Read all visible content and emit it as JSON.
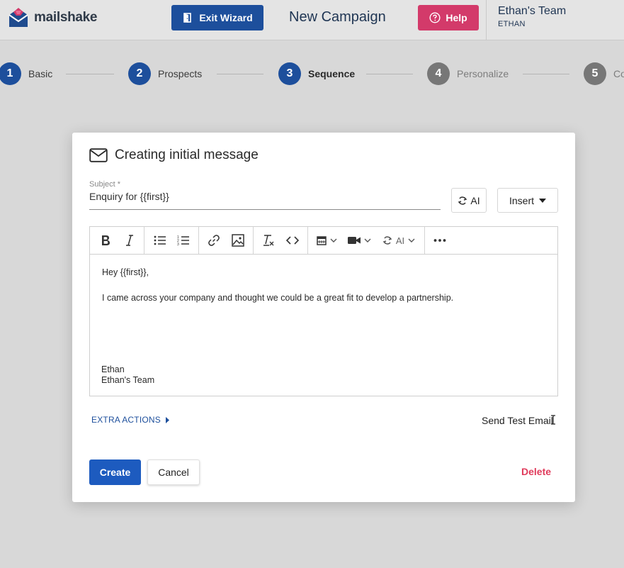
{
  "header": {
    "brand": "mailshake",
    "exit_wizard": "Exit Wizard",
    "title": "New Campaign",
    "help": "Help",
    "team_name": "Ethan's Team",
    "team_user": "ETHAN"
  },
  "steps": [
    {
      "num": "1",
      "label": "Basic",
      "state": "done"
    },
    {
      "num": "2",
      "label": "Prospects",
      "state": "done"
    },
    {
      "num": "3",
      "label": "Sequence",
      "state": "current"
    },
    {
      "num": "4",
      "label": "Personalize",
      "state": "todo"
    },
    {
      "num": "5",
      "label": "Co",
      "state": "todo"
    }
  ],
  "modal": {
    "title": "Creating initial message",
    "subject_label": "Subject *",
    "subject_value": "Enquiry for {{first}}",
    "ai_button": "AI",
    "insert_button": "Insert",
    "toolbar_ai": "AI",
    "body": {
      "greeting": "Hey {{first}},",
      "line1": "I came across your company and thought we could be a great fit to develop a partnership.",
      "sig_name": "Ethan",
      "sig_team": "Ethan's Team"
    },
    "extra_actions": "EXTRA ACTIONS",
    "send_test": "Send Test Email",
    "create": "Create",
    "cancel": "Cancel",
    "delete": "Delete"
  },
  "colors": {
    "primary": "#1d4f9c",
    "create": "#1d5bbf",
    "help": "#d33a6a",
    "delete": "#e03c5c",
    "inactive_step": "#777777"
  },
  "icons": [
    "logo-icon",
    "door-icon",
    "help-circle-icon",
    "envelope-icon",
    "ai-refresh-icon",
    "caret-down-icon",
    "bold-icon",
    "italic-icon",
    "bullet-list-icon",
    "numbered-list-icon",
    "link-icon",
    "image-icon",
    "clear-format-icon",
    "code-icon",
    "calendar-icon",
    "video-icon",
    "more-icon",
    "caret-right-icon"
  ]
}
